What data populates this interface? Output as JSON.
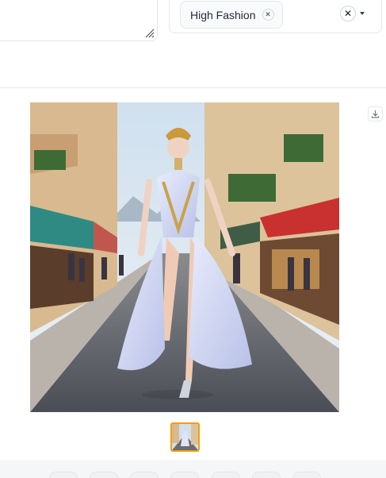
{
  "tags": {
    "selected": [
      {
        "label": "High Fashion"
      }
    ],
    "clear_icon": "close-icon",
    "dropdown_icon": "chevron-down-icon"
  },
  "gallery": {
    "main_image_desc": "generated-image",
    "download_icon": "download-icon",
    "thumbnail_count": 1
  },
  "colors": {
    "accent": "#f59e0b",
    "border": "#e5e7eb",
    "background": "#f9fafb"
  }
}
